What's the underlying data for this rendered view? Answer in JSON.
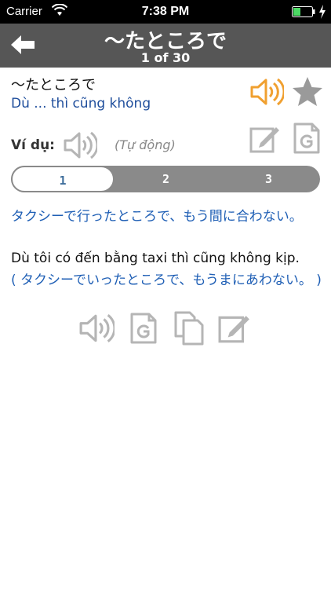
{
  "status_bar": {
    "carrier": "Carrier",
    "time": "7:38 PM"
  },
  "nav": {
    "title": "〜たところで",
    "counter": "1 of 30"
  },
  "entry": {
    "term": "〜たところで",
    "meaning": "Dù ... thì cũng không"
  },
  "examples": {
    "label": "Ví dụ:",
    "mode": "(Tự động)",
    "tabs": [
      "1",
      "2",
      "3"
    ],
    "active_tab": "1",
    "japanese": "タクシーで行ったところで、もう間に合わない。",
    "vietnamese": "Dù tôi có đến bằng taxi thì cũng không kịp.",
    "reading": "( タクシーでいったところで、もうまにあわない。 )"
  },
  "colors": {
    "nav_bg": "#565656",
    "meaning": "#1f4e9c",
    "example_text": "#1f5fb5",
    "speaker_active": "#f0a030",
    "icon_gray": "#b5b5b5",
    "tab_active_text": "#3d6d9b"
  },
  "icons": {
    "back": "back-arrow-icon",
    "speaker": "speaker-icon",
    "favorite": "star-icon",
    "edit": "edit-icon",
    "google": "google-translate-icon",
    "copy": "copy-icon"
  }
}
